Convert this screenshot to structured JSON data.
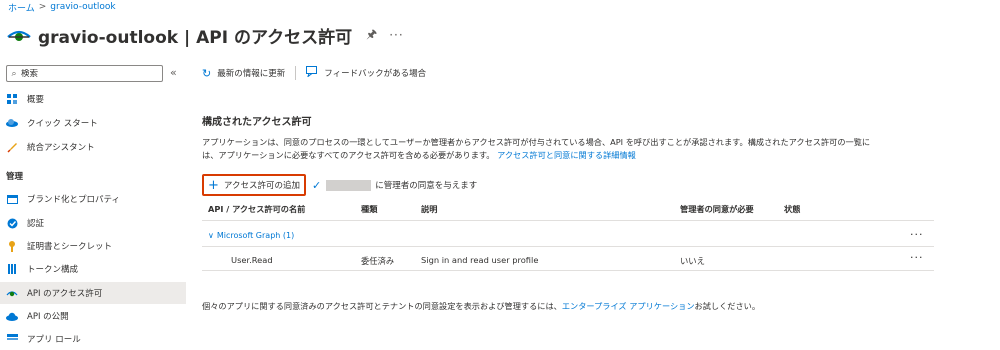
{
  "breadcrumb": {
    "home": "ホーム",
    "separator": ">",
    "current": "gravio-outlook"
  },
  "title": {
    "text": "gravio-outlook | API のアクセス許可",
    "pin_icon": "pin-icon",
    "more": "···"
  },
  "sidebar": {
    "search_placeholder": "検索",
    "collapse": "«",
    "items_top": [
      {
        "label": "概要",
        "icon": "overview-icon",
        "color": "#0078d4"
      },
      {
        "label": "クイック スタート",
        "icon": "cloud-icon",
        "color": "#0078d4"
      },
      {
        "label": "統合アシスタント",
        "icon": "rocket-icon",
        "color": "#e8a317"
      }
    ],
    "section_label": "管理",
    "items_manage": [
      {
        "label": "ブランド化とプロパティ",
        "icon": "branding-icon",
        "color": "#0078d4"
      },
      {
        "label": "認証",
        "icon": "authentication-icon",
        "color": "#0078d4"
      },
      {
        "label": "証明書とシークレット",
        "icon": "key-icon",
        "color": "#e8a317"
      },
      {
        "label": "トークン構成",
        "icon": "token-config-icon",
        "color": "#0078d4"
      },
      {
        "label": "API のアクセス許可",
        "icon": "api-permissions-icon",
        "color": "#107c10",
        "selected": true
      },
      {
        "label": "API の公開",
        "icon": "cloud-expose-icon",
        "color": "#0078d4"
      },
      {
        "label": "アプリ ロール",
        "icon": "app-roles-icon",
        "color": "#0078d4"
      }
    ]
  },
  "toolbar": {
    "refresh": "最新の情報に更新",
    "feedback": "フィードバックがある場合"
  },
  "main": {
    "section_title": "構成されたアクセス許可",
    "description_1": "アプリケーションは、同意のプロセスの一環としてユーザーか管理者からアクセス許可が付与されている場合、API を呼び出すことが承認されます。構成されたアクセス許可の一覧に",
    "description_2": "は、アプリケーションに必要なすべてのアクセス許可を含める必要があります。",
    "description_link": "アクセス許可と同意に関する詳細情報",
    "add_permission": "アクセス許可の追加",
    "grant_consent": "に管理者の同意を与えます"
  },
  "table": {
    "headers": [
      "API / アクセス許可の名前",
      "種類",
      "説明",
      "管理者の同意が必要",
      "状態"
    ],
    "group": "Microsoft Graph (1)",
    "rows": [
      {
        "name": "User.Read",
        "type": "委任済み",
        "description": "Sign in and read user profile",
        "admin_consent": "いいえ",
        "status": ""
      }
    ],
    "more": "···"
  },
  "footer": {
    "text_before": "個々のアプリに関する同意済みのアクセス許可とテナントの同意設定を表示および管理するには、",
    "link": "エンタープライズ アプリケーション",
    "text_after": "お試しください。"
  },
  "colors": {
    "accent": "#0078d4",
    "highlight_border": "#d83b01",
    "selected_bg": "#edebe9"
  }
}
